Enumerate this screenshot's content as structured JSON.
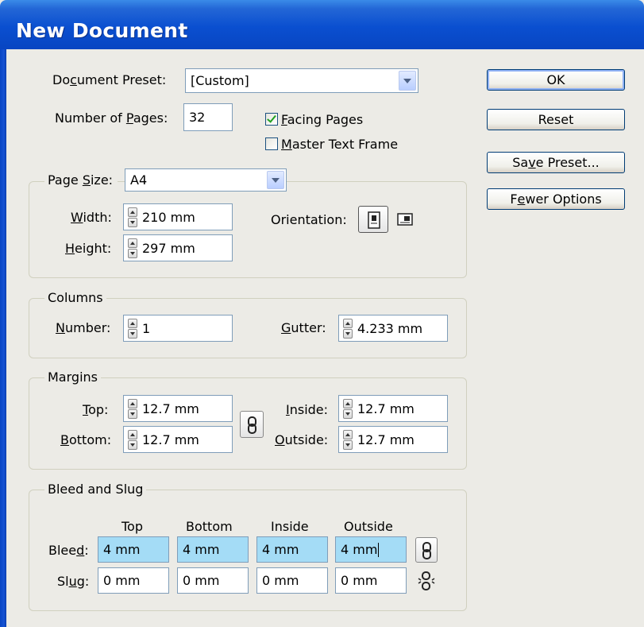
{
  "window": {
    "title": "New Document"
  },
  "preset": {
    "label": "Document Preset:",
    "value": "[Custom]"
  },
  "pages": {
    "label": "Number of Pages:",
    "value": "32",
    "facing_label": "Facing Pages",
    "facing_checked": true,
    "master_label": "Master Text Frame",
    "master_checked": false
  },
  "page_size": {
    "label": "Page Size:",
    "value": "A4",
    "width_label": "Width:",
    "width": "210 mm",
    "height_label": "Height:",
    "height": "297 mm",
    "orientation_label": "Orientation:",
    "orientation_icons": [
      "portrait-orientation-icon",
      "landscape-orientation-icon"
    ]
  },
  "columns": {
    "title": "Columns",
    "number_label": "Number:",
    "number": "1",
    "gutter_label": "Gutter:",
    "gutter": "4.233 mm"
  },
  "margins": {
    "title": "Margins",
    "top_label": "Top:",
    "top": "12.7 mm",
    "bottom_label": "Bottom:",
    "bottom": "12.7 mm",
    "inside_label": "Inside:",
    "inside": "12.7 mm",
    "outside_label": "Outside:",
    "outside": "12.7 mm",
    "link_icon": "chain-link-icon"
  },
  "bleed_slug": {
    "title": "Bleed and Slug",
    "headers": [
      "Top",
      "Bottom",
      "Inside",
      "Outside"
    ],
    "bleed_label": "Bleed:",
    "bleed": [
      "4 mm",
      "4 mm",
      "4 mm",
      "4 mm"
    ],
    "slug_label": "Slug:",
    "slug": [
      "0 mm",
      "0 mm",
      "0 mm",
      "0 mm"
    ],
    "bleed_link_icon": "chain-link-icon",
    "slug_link_icon": "broken-chain-link-icon"
  },
  "buttons": {
    "ok": "OK",
    "reset": "Reset",
    "save_preset": "Save Preset...",
    "fewer_options": "Fewer Options"
  },
  "colors": {
    "titlebar": "#0a4fd0",
    "selected_field": "#a4dcf6",
    "check_mark": "#21a121"
  }
}
